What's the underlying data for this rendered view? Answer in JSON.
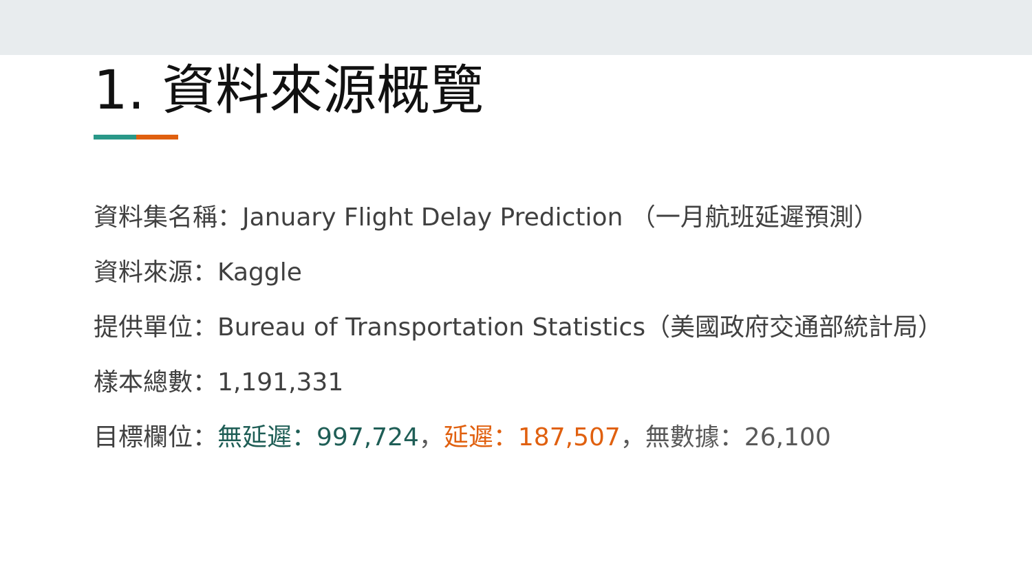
{
  "slide": {
    "title": "1. 資料來源概覽"
  },
  "items": {
    "dataset": {
      "label": "資料集名稱：",
      "value": "January Flight Delay Prediction （一月航班延遲預測）"
    },
    "source": {
      "label": "資料來源：",
      "value": "Kaggle"
    },
    "provider": {
      "label": "提供單位：",
      "value": "Bureau of Transportation Statistics（美國政府交通部統計局）"
    },
    "samples": {
      "label": "樣本總數：",
      "value": "1,191,331"
    },
    "target": {
      "label": "目標欄位：",
      "no_delay": "無延遲：997,724",
      "sep1": "，",
      "delay": "延遲：187,507",
      "sep2": "，",
      "no_data": "無數據：26,100"
    }
  },
  "colors": {
    "accent_teal": "#2a9888",
    "accent_orange": "#e0600f",
    "no_delay": "#1f5e56",
    "delay": "#e0600f",
    "no_data": "#595959",
    "header_band": "#e8ecee"
  }
}
